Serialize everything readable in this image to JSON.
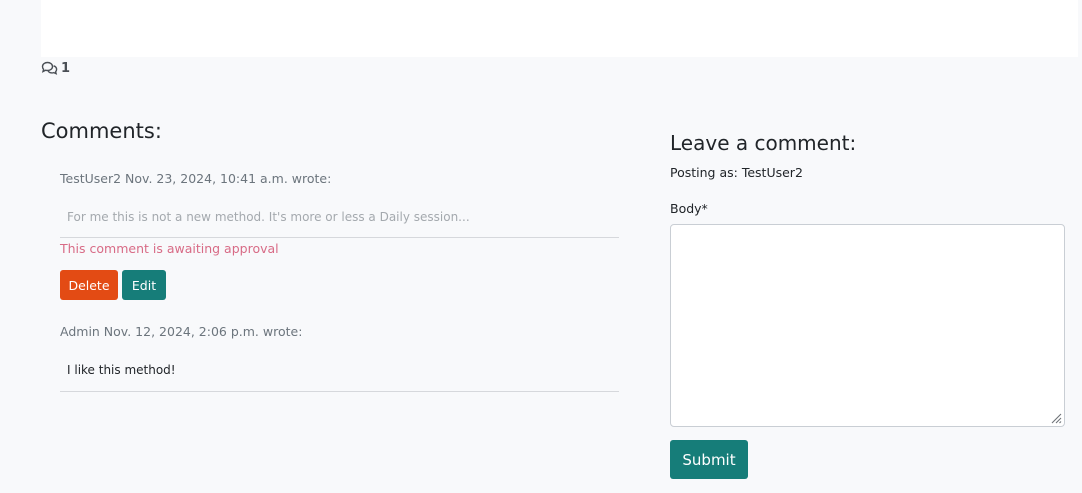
{
  "post": {
    "comment_count": "1"
  },
  "comments_section": {
    "title": "Comments:",
    "comments": [
      {
        "author_line": "TestUser2 Nov. 23, 2024, 10:41 a.m. wrote:",
        "body": "For me this is not a new method. It's more or less a Daily session...",
        "status": "This comment is awaiting approval",
        "delete_label": "Delete",
        "edit_label": "Edit"
      },
      {
        "author_line": "Admin Nov. 12, 2024, 2:06 p.m. wrote:",
        "body": "I like this method!"
      }
    ]
  },
  "comment_form": {
    "title": "Leave a comment:",
    "posting_prefix": "Posting as:",
    "posting_user": "TestUser2",
    "body_label": "Body*",
    "body_value": "",
    "submit_label": "Submit"
  },
  "colors": {
    "background": "#f8f9fb",
    "delete": "#e34b14",
    "accent": "#167d79",
    "pending": "#d86b86"
  },
  "icons": {
    "comment_count": "comments-icon",
    "resize": "resize-grip-icon"
  }
}
